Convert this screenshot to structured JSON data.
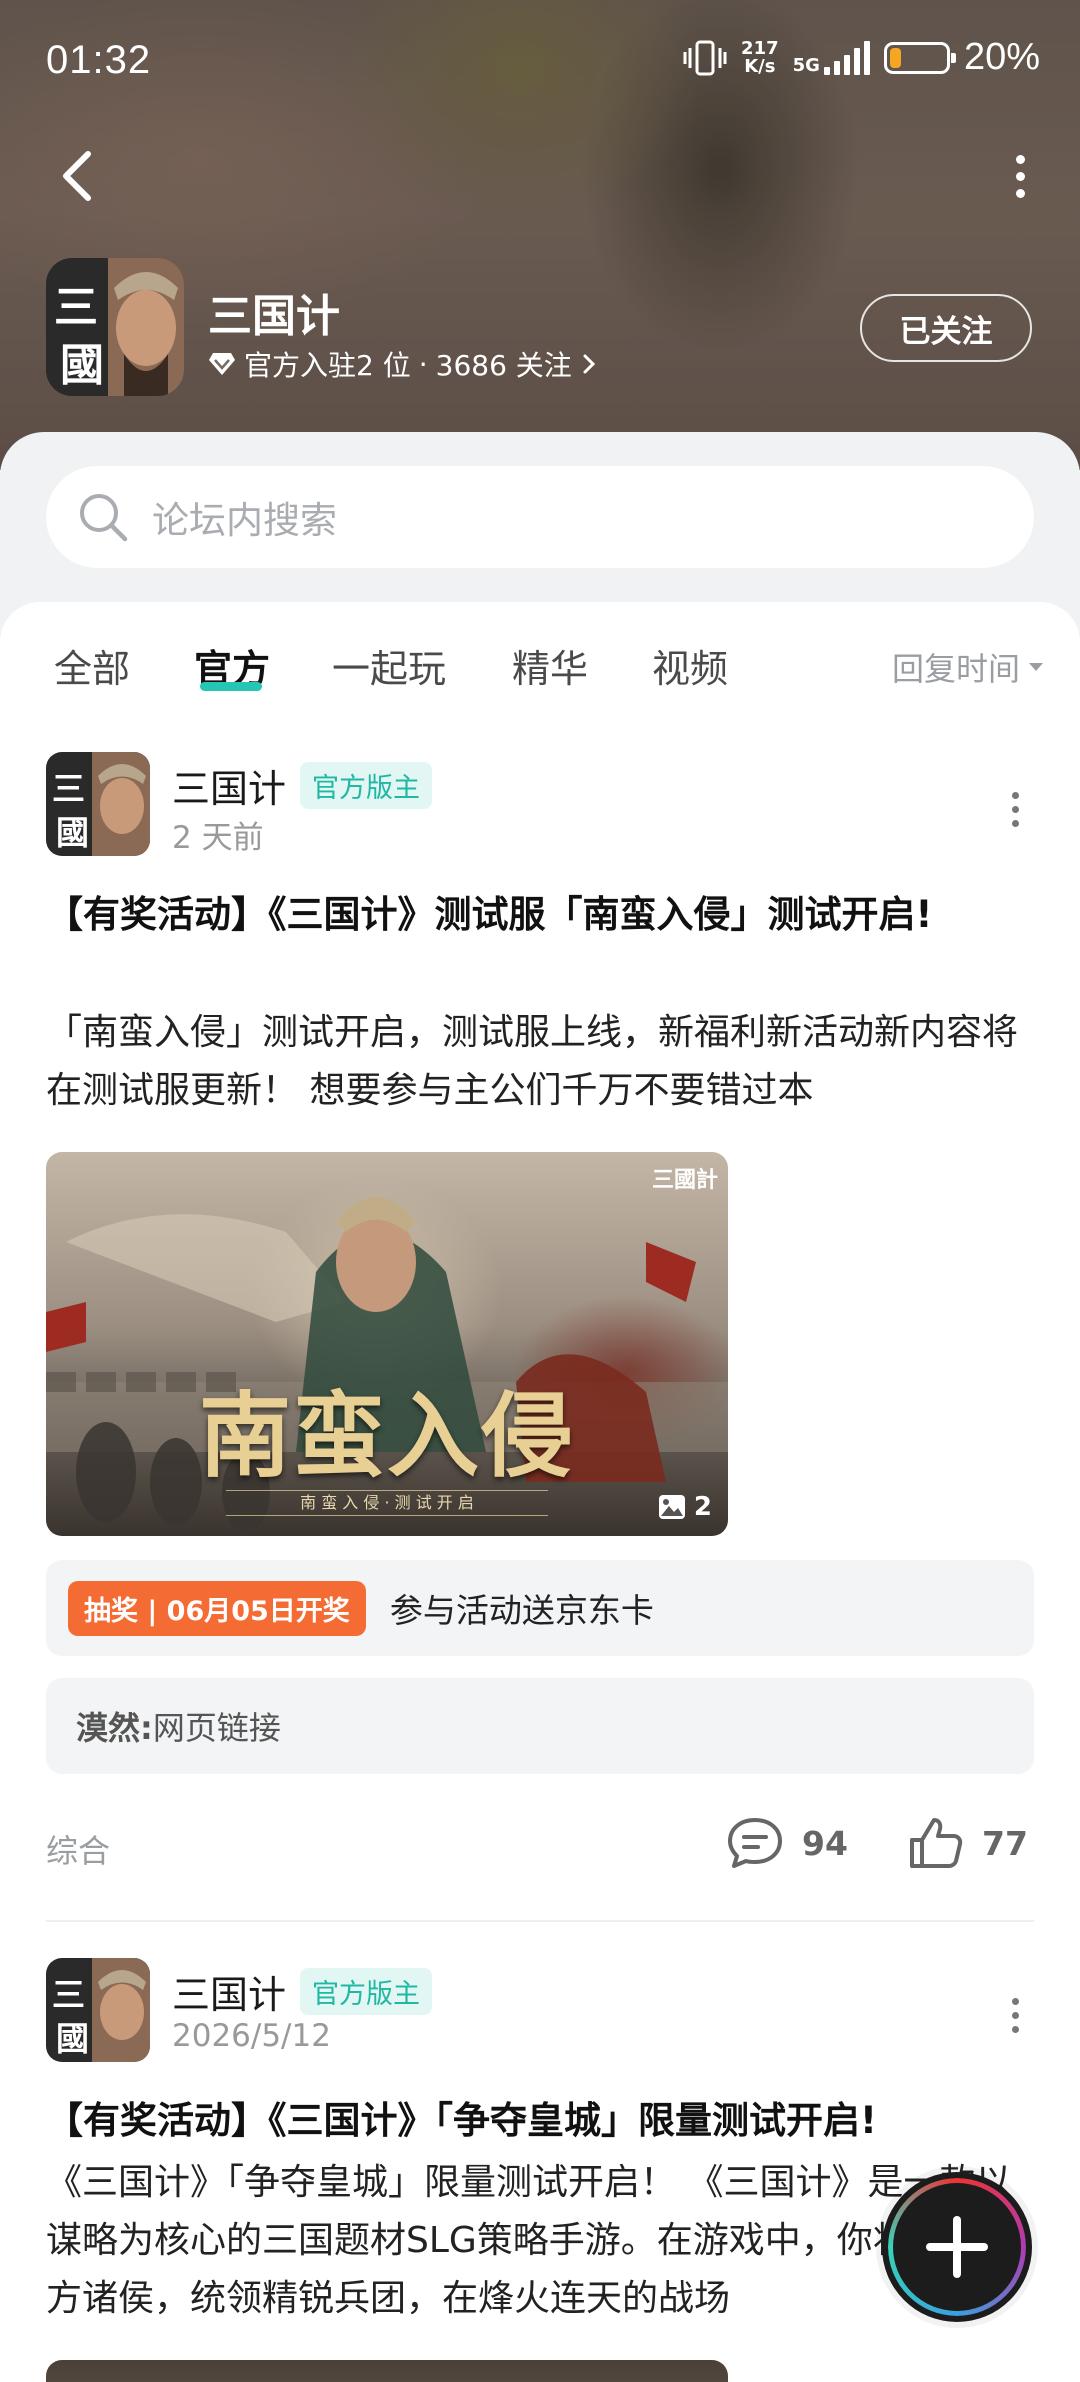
{
  "status_bar": {
    "time": "01:32",
    "net_speed_value": "217",
    "net_speed_unit": "K/s",
    "network": "5G",
    "battery_percent": "20%",
    "battery_level": 0.2,
    "battery_color": "#f5a623"
  },
  "nav": {
    "back_icon": "chevron-left-icon",
    "more_icon": "more-vertical-icon"
  },
  "forum": {
    "name": "三国计",
    "avatar_text": "三國",
    "meta_rank": "官方入驻2 位",
    "meta_sep": "·",
    "meta_followers": "3686 关注",
    "follow_button": "已关注"
  },
  "search": {
    "placeholder": "论坛内搜索"
  },
  "tabs": {
    "items": [
      "全部",
      "官方",
      "一起玩",
      "精华",
      "视频"
    ],
    "active_index": 1,
    "sort_label": "回复时间"
  },
  "posts": [
    {
      "author": "三国计",
      "badge": "官方版主",
      "time": "2 天前",
      "title": "【有奖活动】《三国计》测试服「南蛮入侵」测试开启!",
      "body": "「南蛮入侵」测试开启，测试服上线，新福利新活动新内容将在测试服更新！ 想要参与主公们千万不要错过本",
      "image": {
        "title": "南蛮入侵",
        "subtitle": "南 蛮 入 侵 · 测 试 开 启",
        "logo": "三國計",
        "count": "2"
      },
      "lottery": {
        "tag": "抽奖 | 06月05日开奖",
        "text": "参与活动送京东卡"
      },
      "link": {
        "user": "漠然:",
        "text": "网页链接"
      },
      "category": "综合",
      "comments": "94",
      "likes": "77"
    },
    {
      "author": "三国计",
      "badge": "官方版主",
      "time": "2026/5/12",
      "title": "【有奖活动】《三国计》「争夺皇城」限量测试开启!",
      "body": "《三国计》「争夺皇城」限量测试开启！ 《三国计》是一款以谋略为核心的三国题材SLG策略手游。在游戏中，你将化身一方诸侯，统领精锐兵团，在烽火连天的战场"
    }
  ],
  "fab": {
    "icon": "plus-icon"
  },
  "colors": {
    "accent": "#25c7b4",
    "badge_text": "#20b8a4",
    "lottery_tag": "#f46b34"
  }
}
